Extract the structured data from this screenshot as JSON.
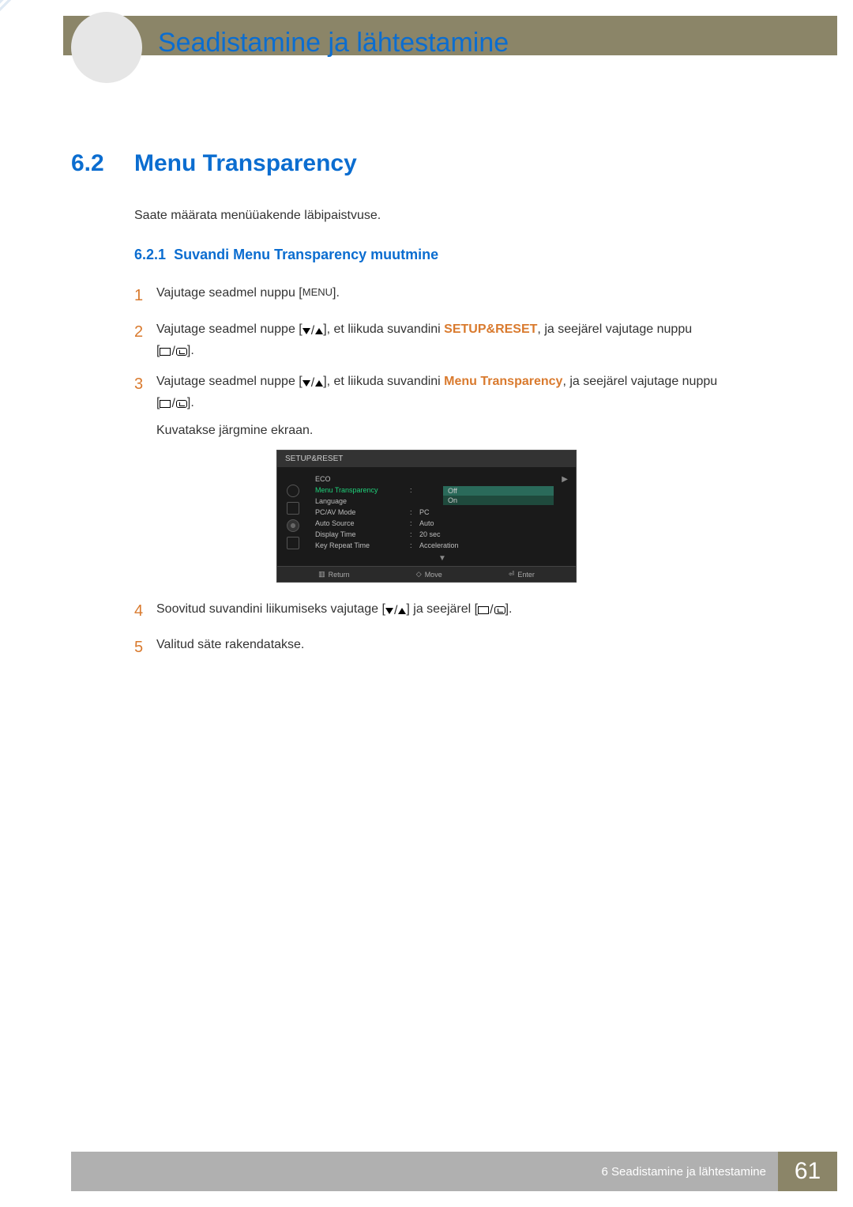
{
  "header": {
    "chapter_title": "Seadistamine ja lähtestamine"
  },
  "section": {
    "number": "6.2",
    "title": "Menu Transparency",
    "intro": "Saate määrata menüüakende läbipaistvuse."
  },
  "subsection": {
    "number": "6.2.1",
    "title": "Suvandi Menu Transparency muutmine"
  },
  "steps": {
    "s1": {
      "num": "1",
      "t1": "Vajutage seadmel nuppu [",
      "menu_label": "MENU",
      "t2": "]."
    },
    "s2": {
      "num": "2",
      "t1": "Vajutage seadmel nuppe [",
      "t2": "], et liikuda suvandini ",
      "highlight": "SETUP&RESET",
      "t3": ", ja seejärel vajutage nuppu",
      "t4": "[",
      "t5": "]."
    },
    "s3": {
      "num": "3",
      "t1": "Vajutage seadmel nuppe [",
      "t2": "], et liikuda suvandini ",
      "highlight": "Menu Transparency",
      "t3": ", ja seejärel vajutage nuppu",
      "t4": "[",
      "t5": "].",
      "after": "Kuvatakse järgmine ekraan."
    },
    "s4": {
      "num": "4",
      "t1": "Soovitud suvandini liikumiseks vajutage [",
      "t2": "] ja seejärel [",
      "t3": "]."
    },
    "s5": {
      "num": "5",
      "text": "Valitud säte rakendatakse."
    }
  },
  "osd": {
    "title": "SETUP&RESET",
    "rows": [
      {
        "label": "ECO",
        "value": ""
      },
      {
        "label": "Menu Transparency",
        "value": "Off",
        "selected": true
      },
      {
        "label": "Language",
        "value": ""
      },
      {
        "label": "PC/AV Mode",
        "value": "PC"
      },
      {
        "label": "Auto Source",
        "value": "Auto"
      },
      {
        "label": "Display Time",
        "value": "20 sec"
      },
      {
        "label": "Key Repeat Time",
        "value": "Acceleration"
      }
    ],
    "options": {
      "off": "Off",
      "on": "On"
    },
    "footer": {
      "return": "Return",
      "move": "Move",
      "enter": "Enter"
    }
  },
  "footer": {
    "chapter_ref": "6 Seadistamine ja lähtestamine",
    "page": "61"
  }
}
